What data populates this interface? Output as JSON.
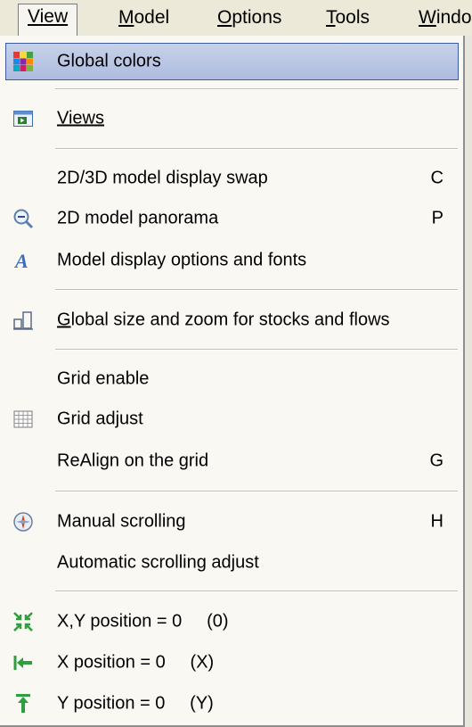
{
  "menubar": {
    "items": [
      {
        "label": "View",
        "accel_index": 0,
        "active": true
      },
      {
        "label": "Model",
        "accel_index": 0
      },
      {
        "label": "Options",
        "accel_index": 0
      },
      {
        "label": "Tools",
        "accel_index": 0
      },
      {
        "label": "Windo",
        "accel_index": 0
      }
    ]
  },
  "menu": {
    "items": [
      {
        "label": "Global colors",
        "shortcut": "",
        "icon": "palette-icon",
        "highlighted": true
      },
      {
        "label": "Views",
        "shortcut": "",
        "icon": "views-icon"
      },
      {
        "label": "2D/3D model display swap",
        "shortcut": "C",
        "icon": ""
      },
      {
        "label": "2D model panorama",
        "shortcut": "P",
        "icon": "zoom-out-icon"
      },
      {
        "label": "Model display options and fonts",
        "shortcut": "",
        "icon": "font-icon"
      },
      {
        "label": "Global size and zoom for stocks and flows",
        "shortcut": "",
        "icon": "size-icon"
      },
      {
        "label": "Grid enable",
        "shortcut": "",
        "icon": ""
      },
      {
        "label": "Grid adjust",
        "shortcut": "",
        "icon": "grid-icon"
      },
      {
        "label": "ReAlign on the grid",
        "shortcut": "G",
        "icon": ""
      },
      {
        "label": "Manual scrolling",
        "shortcut": "H",
        "icon": "compass-icon"
      },
      {
        "label": "Automatic scrolling adjust",
        "shortcut": "",
        "icon": ""
      },
      {
        "label": "X,Y position = 0     (0)",
        "shortcut": "",
        "icon": "xy-position-icon"
      },
      {
        "label": "X position = 0     (X)",
        "shortcut": "",
        "icon": "x-position-icon"
      },
      {
        "label": "Y position = 0     (Y)",
        "shortcut": "",
        "icon": "y-position-icon"
      }
    ]
  }
}
